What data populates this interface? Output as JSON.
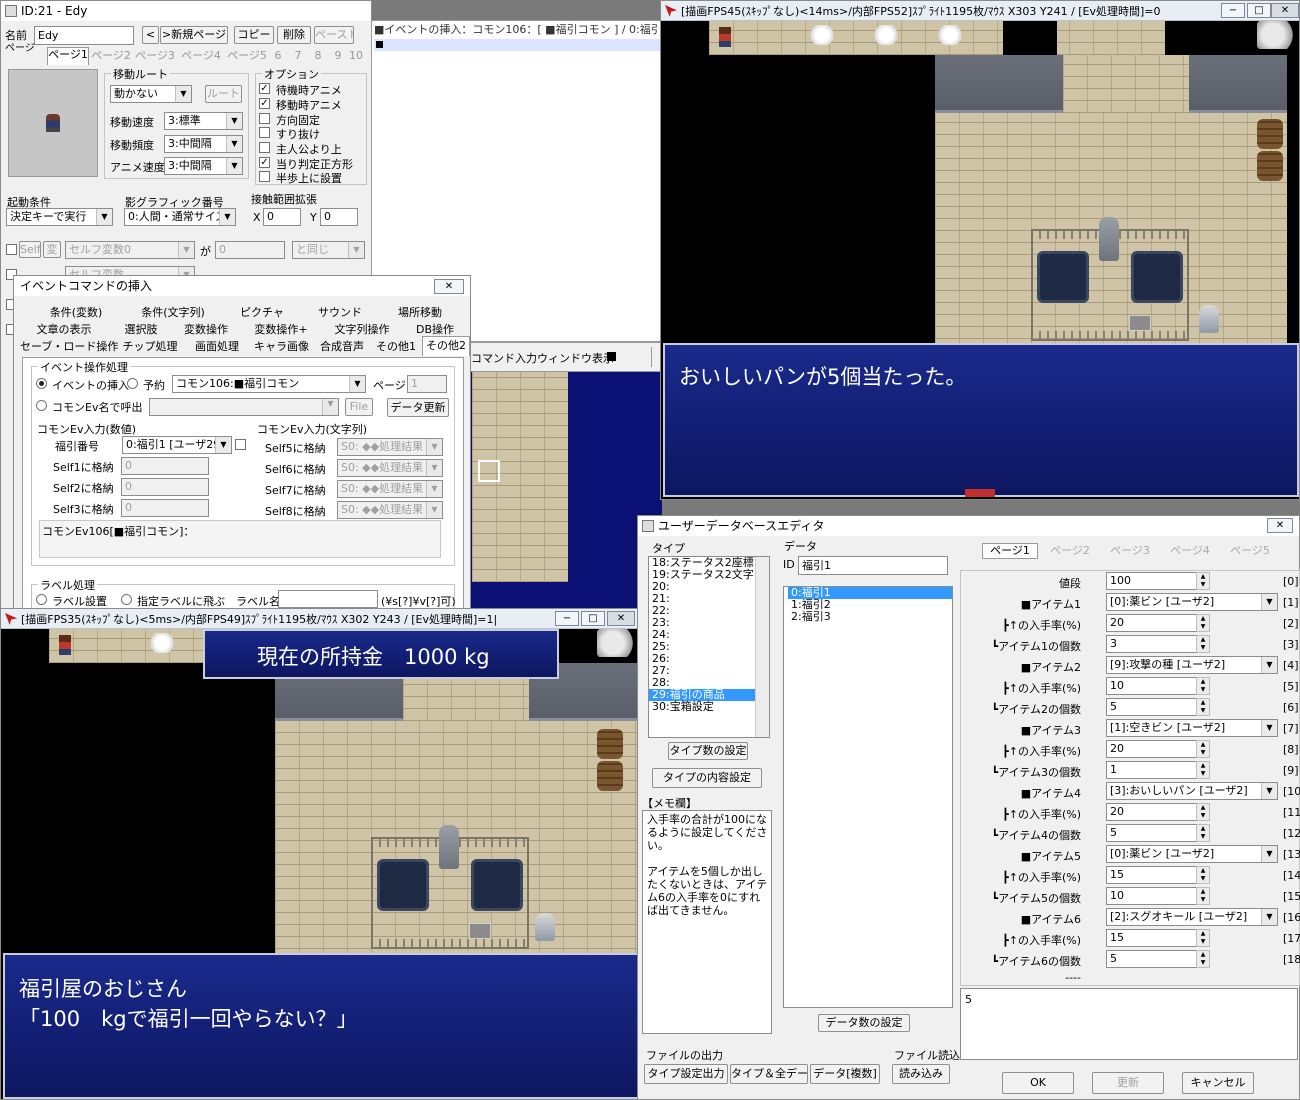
{
  "event_editor": {
    "title": "ID:21 - Edy",
    "name_label": "名前",
    "name_value": "Edy",
    "page_label": "ページ",
    "prev_btn": "<",
    "new_page_btn": ">新規ページ",
    "copy_btn": "コピー",
    "delete_btn": "削除",
    "paste_btn": "ペースト",
    "page_tabs": [
      "ページ1",
      "ページ2",
      "ページ3",
      "ページ4",
      "ページ5",
      "6",
      "7",
      "8",
      "9",
      "10"
    ],
    "move_route": {
      "title": "移動ルート",
      "type_value": "動かない",
      "route_btn": "ルート",
      "speed_label": "移動速度",
      "speed_value": "3:標準",
      "freq_label": "移動頻度",
      "freq_value": "3:中間隔",
      "anim_label": "アニメ速度",
      "anim_value": "3:中間隔"
    },
    "options": {
      "title": "オプション",
      "items": [
        {
          "label": "待機時アニメ",
          "checked": "✓"
        },
        {
          "label": "移動時アニメ",
          "checked": "✓"
        },
        {
          "label": "方向固定",
          "checked": ""
        },
        {
          "label": "すり抜け",
          "checked": ""
        },
        {
          "label": "主人公より上",
          "checked": ""
        },
        {
          "label": "当り判定正方形",
          "checked": "✓"
        },
        {
          "label": "半歩上に設置",
          "checked": ""
        }
      ]
    },
    "start_cond_label": "起動条件",
    "start_cond_value": "決定キーで実行",
    "shadow_label": "影グラフィック番号",
    "shadow_value": "0:人間・通常サイズ",
    "range_label": "接触範囲拡張",
    "range_x_label": "X",
    "range_x_value": "0",
    "range_y_label": "Y",
    "range_y_value": "0",
    "cond1": {
      "self_label": "Self",
      "var_btn": "変",
      "var_value": "セルフ変数0",
      "ga": "が",
      "num": "0",
      "op": "と同じ"
    },
    "cond2": {
      "var_value": "セルフ変数"
    },
    "event_header_text": "■イベントの挿入：コモン106：[ ■福引コモン ] / 0:福引1",
    "cmd_window_text": "コマンド入力ウィンドウ表示"
  },
  "insert_dialog": {
    "title": "イベントコマンドの挿入",
    "tab_row1": [
      "条件(変数)",
      "条件(文字列)",
      "ピクチャ",
      "サウンド",
      "場所移動"
    ],
    "tab_row2": [
      "文章の表示",
      "選択肢",
      "変数操作",
      "変数操作+",
      "文字列操作",
      "DB操作"
    ],
    "tab_row3": [
      "セーブ・ロード操作",
      "チップ処理",
      "画面処理",
      "キャラ画像",
      "合成音声",
      "その他1",
      "その他2"
    ],
    "group_event": "イベント操作処理",
    "radio_insert": "イベントの挿入",
    "radio_reserve": "予約",
    "common_value": "コモン106:■福引コモン",
    "page_label": "ページ",
    "page_value": "1",
    "radio_callname": "コモンEv名で呼出",
    "file_btn": "File",
    "data_update_btn": "データ更新",
    "num_input_title": "コモンEv入力(数値)",
    "str_input_title": "コモンEv入力(文字列)",
    "num_rows": [
      {
        "label": "福引番号",
        "value": "0:福引1 [ユーザ29]"
      },
      {
        "label": "Self1に格納",
        "value": "0"
      },
      {
        "label": "Self2に格納",
        "value": "0"
      },
      {
        "label": "Self3に格納",
        "value": "0"
      }
    ],
    "str_rows": [
      {
        "label": "Self5に格納",
        "value": "S0: ◆◆処理結果"
      },
      {
        "label": "Self6に格納",
        "value": "S0: ◆◆処理結果"
      },
      {
        "label": "Self7に格納",
        "value": "S0: ◆◆処理結果"
      },
      {
        "label": "Self8に格納",
        "value": "S0: ◆◆処理結果"
      }
    ],
    "memo": "コモンEv106[■福引コモン]：",
    "label_group": "ラベル処理",
    "radio_label_set": "ラベル設置",
    "radio_label_jump": "指定ラベルに飛ぶ",
    "label_name": "ラベル名",
    "label_hint": "(¥s[?]¥v[?]可)"
  },
  "game_top": {
    "title": "[描画FPS45(ｽｷｯﾌﾟなし)<14ms>/内部FPS52]ｽﾌﾟﾗｲﾄ1195枚/ﾏｳｽ X303 Y241 / [Ev処理時間]=0",
    "message": "おいしいパンが5個当たった。"
  },
  "game_bottom": {
    "title": "[描画FPS35(ｽｷｯﾌﾟなし)<5ms>/内部FPS49]ｽﾌﾟﾗｲﾄ1195枚/ﾏｳｽ X302 Y243 / [Ev処理時間]=1|",
    "money": "現在の所持金　1000 kg",
    "message_line1": "福引屋のおじさん",
    "message_line2": "「100　kgで福引一回やらない？」"
  },
  "db_editor": {
    "title": "ユーザーデータベースエディタ",
    "type_label": "タイプ",
    "types": [
      "18:ステータス2座標",
      "19:ステータス2文字",
      "20:",
      "21:",
      "22:",
      "23:",
      "24:",
      "25:",
      "26:",
      "27:",
      "28:",
      "29:福引の商品",
      "30:宝箱設定"
    ],
    "selected_type": "29:福引の商品",
    "type_count_btn": "タイプ数の設定",
    "type_content_btn": "タイプの内容設定",
    "memo_label": "【メモ欄】",
    "memo_text": "入手率の合計が100になるように設定してください。\n\nアイテムを5個しか出したくないときは、アイテム6の入手率を0にすれば出てきません。",
    "data_label": "データ",
    "id_label": "ID",
    "id_value": "福引1",
    "data_items": [
      "0:福引1",
      "1:福引2",
      "2:福引3"
    ],
    "data_count_btn": "データ数の設定",
    "file_out_label": "ファイルの出力",
    "type_out_btn": "タイプ設定出力",
    "all_data_btn": "タイプ＆全データ",
    "data_copy_btn": "データ[複数]",
    "file_in_label": "ファイル読込",
    "read_btn": "読み込み",
    "pages": [
      "ページ1",
      "ページ2",
      "ページ3",
      "ページ4",
      "ページ5"
    ],
    "fields": [
      {
        "label": "値段",
        "value": "100",
        "num": "[0]",
        "kind": "input"
      },
      {
        "label": "■アイテム1",
        "value": "[0]:薬ビン [ユーザ2]",
        "num": "[1]",
        "kind": "select"
      },
      {
        "label": "┣↑の入手率(%)",
        "value": "20",
        "num": "[2]",
        "kind": "input"
      },
      {
        "label": "┗アイテム1の個数",
        "value": "3",
        "num": "[3]",
        "kind": "input"
      },
      {
        "label": "■アイテム2",
        "value": "[9]:攻撃の種 [ユーザ2]",
        "num": "[4]",
        "kind": "select"
      },
      {
        "label": "┣↑の入手率(%)",
        "value": "10",
        "num": "[5]",
        "kind": "input"
      },
      {
        "label": "┗アイテム2の個数",
        "value": "5",
        "num": "[6]",
        "kind": "input"
      },
      {
        "label": "■アイテム3",
        "value": "[1]:空きビン [ユーザ2]",
        "num": "[7]",
        "kind": "select"
      },
      {
        "label": "┣↑の入手率(%)",
        "value": "20",
        "num": "[8]",
        "kind": "input"
      },
      {
        "label": "┗アイテム3の個数",
        "value": "1",
        "num": "[9]",
        "kind": "input"
      },
      {
        "label": "■アイテム4",
        "value": "[3]:おいしいパン [ユーザ2]",
        "num": "[10]",
        "kind": "select"
      },
      {
        "label": "┣↑の入手率(%)",
        "value": "20",
        "num": "[11]",
        "kind": "input"
      },
      {
        "label": "┗アイテム4の個数",
        "value": "5",
        "num": "[12]",
        "kind": "input"
      },
      {
        "label": "■アイテム5",
        "value": "[0]:薬ビン [ユーザ2]",
        "num": "[13]",
        "kind": "select"
      },
      {
        "label": "┣↑の入手率(%)",
        "value": "15",
        "num": "[14]",
        "kind": "input"
      },
      {
        "label": "┗アイテム5の個数",
        "value": "10",
        "num": "[15]",
        "kind": "input"
      },
      {
        "label": "■アイテム6",
        "value": "[2]:スグオキール [ユーザ2]",
        "num": "[16]",
        "kind": "select"
      },
      {
        "label": "┣↑の入手率(%)",
        "value": "15",
        "num": "[17]",
        "kind": "input"
      },
      {
        "label": "┗アイテム6の個数",
        "value": "5",
        "num": "[18]",
        "kind": "input"
      },
      {
        "label": "----",
        "value": "",
        "num": "",
        "kind": "blank"
      }
    ],
    "bottom_text": "5",
    "ok_btn": "OK",
    "update_btn": "更新",
    "cancel_btn": "キャンセル"
  }
}
